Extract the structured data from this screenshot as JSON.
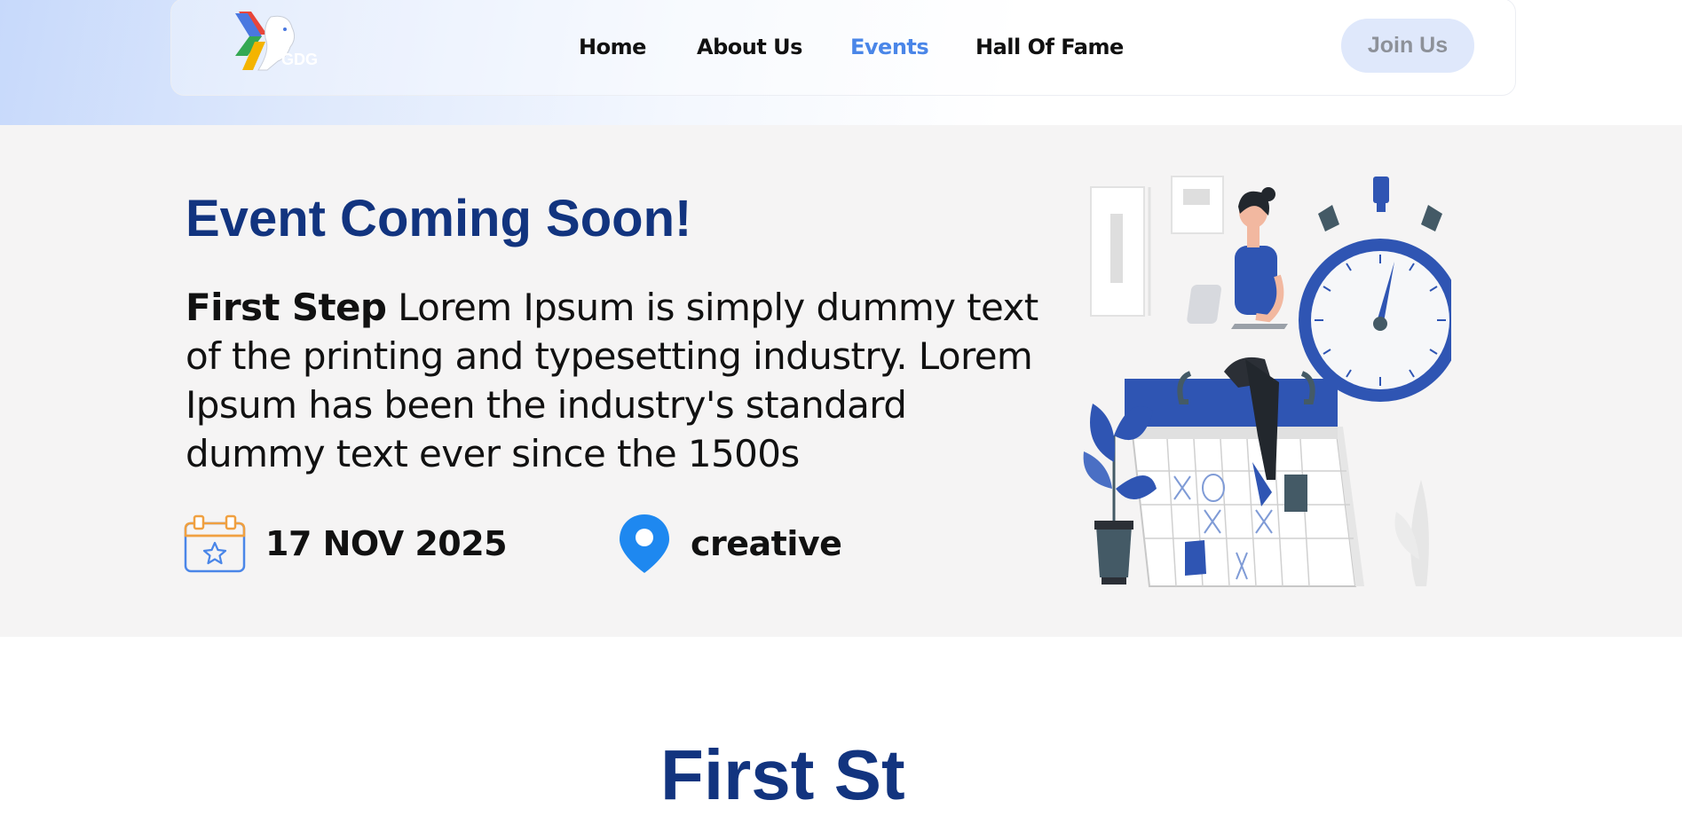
{
  "brand": {
    "logo_text": "GDG"
  },
  "nav": {
    "items": [
      {
        "label": "Home",
        "active": false
      },
      {
        "label": "About Us",
        "active": false
      },
      {
        "label": "Events",
        "active": true
      },
      {
        "label": "Hall Of Fame",
        "active": false
      }
    ],
    "join_label": "Join Us"
  },
  "hero": {
    "title": "Event Coming Soon!",
    "event_name": "First Step",
    "description": " Lorem Ipsum is simply dummy text of the printing and typesetting industry. Lorem Ipsum has been the industry's standard dummy text ever since the 1500s",
    "date": "17 NOV 2025",
    "location": "creative",
    "date_icon": "calendar-star-icon",
    "location_icon": "map-pin-icon"
  },
  "section": {
    "heading": "First St"
  },
  "colors": {
    "accent": "#4a86e8",
    "title_blue": "#12347f",
    "join_bg": "#dfe8fb",
    "hero_bg": "#f5f4f4",
    "illustration_blue": "#2f55b3"
  }
}
